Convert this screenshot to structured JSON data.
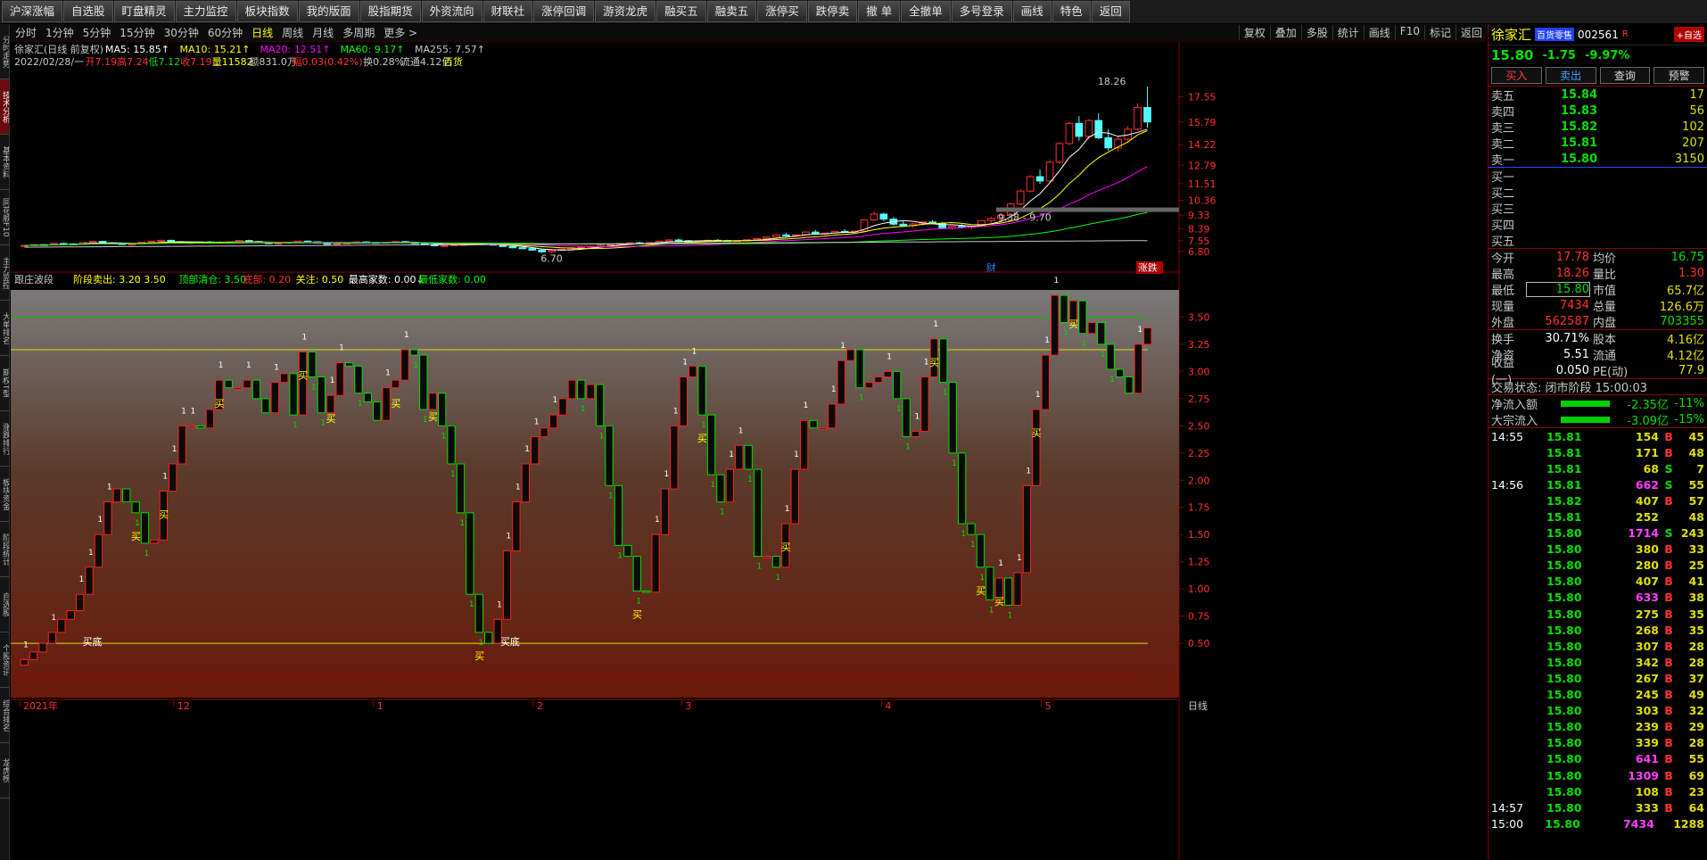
{
  "toolbar": [
    "沪深涨幅",
    "自选股",
    "盯盘精灵",
    "主力监控",
    "板块指数",
    "我的版面",
    "股指期货",
    "外资流向",
    "财联社",
    "涨停回调",
    "游资龙虎",
    "融买五",
    "融卖五",
    "涨停买",
    "跌停卖",
    "撤 单",
    "全撤单",
    "多号登录",
    "画线",
    "特色",
    "返回"
  ],
  "left_tabs": [
    "分时走势",
    "技术分析",
    "基本资料",
    "同花顺F10",
    "主力监控",
    "大单排名",
    "期权T型",
    "涨跌排行",
    "板块资金",
    "阶段统计",
    "自选股",
    "个股资讯",
    "综合排名",
    "龙虎榜"
  ],
  "periods": [
    "分时",
    "1分钟",
    "5分钟",
    "15分钟",
    "30分钟",
    "60分钟",
    "日线",
    "周线",
    "月线",
    "多周期",
    "更多 >"
  ],
  "period_active": "日线",
  "right_buttons": [
    "复权",
    "叠加",
    "多股",
    "统计",
    "画线",
    "F10",
    "标记",
    "返回"
  ],
  "kline": {
    "title": "徐家汇(日线 前复权)",
    "ma_labels": [
      {
        "text": "MA5: 15.85↑",
        "color": "#ffffff"
      },
      {
        "text": "MA10: 15.21↑",
        "color": "#ffff00"
      },
      {
        "text": "MA20: 12.51↑",
        "color": "#ff00ff"
      },
      {
        "text": "MA60: 9.17↑",
        "color": "#00ff00"
      },
      {
        "text": "MA255: 7.57↑",
        "color": "#c8c8c8"
      }
    ],
    "info_line": [
      {
        "text": "2022/02/28/一",
        "color": "#c8c8c8"
      },
      {
        "text": "开7.19",
        "color": "#ff3030"
      },
      {
        "text": "高7.24",
        "color": "#ff3030"
      },
      {
        "text": "低7.12",
        "color": "#00e000"
      },
      {
        "text": "收7.19",
        "color": "#ff3030"
      },
      {
        "text": "量11582",
        "color": "#ffff00"
      },
      {
        "text": "额831.0万",
        "color": "#c8c8c8"
      },
      {
        "text": "幅0.03(0.42%)",
        "color": "#ff3030"
      },
      {
        "text": "换0.28%",
        "color": "#c8c8c8"
      },
      {
        "text": "流通4.12亿",
        "color": "#c8c8c8"
      },
      {
        "text": "百货",
        "color": "#ffff00"
      }
    ],
    "y_ticks": [
      "17.55",
      "15.79",
      "14.22",
      "12.79",
      "11.51",
      "10.36",
      "9.33",
      "8.39",
      "7.55",
      "6.80"
    ],
    "price_scale": {
      "min": 6.3,
      "max": 19.5
    },
    "high_label": "18.26",
    "low_label": "6.70",
    "range_label": "9.38 - 9.70",
    "marker_cai": "财",
    "marker_zt": "涨跌",
    "candles": [
      [
        7.2,
        7.25,
        7.15,
        7.22
      ],
      [
        7.22,
        7.3,
        7.18,
        7.28
      ],
      [
        7.28,
        7.32,
        7.2,
        7.25
      ],
      [
        7.25,
        7.4,
        7.22,
        7.36
      ],
      [
        7.36,
        7.42,
        7.3,
        7.33
      ],
      [
        7.33,
        7.38,
        7.25,
        7.3
      ],
      [
        7.3,
        7.45,
        7.28,
        7.42
      ],
      [
        7.42,
        7.55,
        7.4,
        7.5
      ],
      [
        7.5,
        7.52,
        7.38,
        7.4
      ],
      [
        7.4,
        7.45,
        7.3,
        7.35
      ],
      [
        7.35,
        7.4,
        7.25,
        7.28
      ],
      [
        7.28,
        7.35,
        7.22,
        7.32
      ],
      [
        7.32,
        7.48,
        7.3,
        7.45
      ],
      [
        7.45,
        7.55,
        7.42,
        7.5
      ],
      [
        7.5,
        7.62,
        7.45,
        7.58
      ],
      [
        7.58,
        7.6,
        7.45,
        7.48
      ],
      [
        7.48,
        7.52,
        7.35,
        7.38
      ],
      [
        7.38,
        7.45,
        7.3,
        7.42
      ],
      [
        7.42,
        7.5,
        7.38,
        7.46
      ],
      [
        7.46,
        7.52,
        7.4,
        7.44
      ],
      [
        7.44,
        7.5,
        7.36,
        7.4
      ],
      [
        7.4,
        7.48,
        7.34,
        7.45
      ],
      [
        7.45,
        7.6,
        7.42,
        7.56
      ],
      [
        7.56,
        7.62,
        7.48,
        7.5
      ],
      [
        7.5,
        7.55,
        7.4,
        7.42
      ],
      [
        7.42,
        7.46,
        7.3,
        7.34
      ],
      [
        7.34,
        7.4,
        7.25,
        7.38
      ],
      [
        7.38,
        7.48,
        7.35,
        7.44
      ],
      [
        7.44,
        7.55,
        7.42,
        7.52
      ],
      [
        7.52,
        7.58,
        7.45,
        7.48
      ],
      [
        7.48,
        7.5,
        7.35,
        7.38
      ],
      [
        7.38,
        7.42,
        7.28,
        7.3
      ],
      [
        7.3,
        7.36,
        7.22,
        7.34
      ],
      [
        7.34,
        7.45,
        7.32,
        7.42
      ],
      [
        7.42,
        7.5,
        7.38,
        7.47
      ],
      [
        7.47,
        7.52,
        7.4,
        7.43
      ],
      [
        7.43,
        7.48,
        7.36,
        7.4
      ],
      [
        7.4,
        7.46,
        7.34,
        7.44
      ],
      [
        7.44,
        7.52,
        7.4,
        7.49
      ],
      [
        7.49,
        7.55,
        7.42,
        7.45
      ],
      [
        7.45,
        7.48,
        7.32,
        7.35
      ],
      [
        7.35,
        7.4,
        7.25,
        7.28
      ],
      [
        7.28,
        7.32,
        7.15,
        7.2
      ],
      [
        7.2,
        7.26,
        7.1,
        7.22
      ],
      [
        7.22,
        7.3,
        7.18,
        7.27
      ],
      [
        7.27,
        7.35,
        7.22,
        7.3
      ],
      [
        7.3,
        7.38,
        7.26,
        7.34
      ],
      [
        7.34,
        7.4,
        7.28,
        7.31
      ],
      [
        7.31,
        7.36,
        7.22,
        7.25
      ],
      [
        7.25,
        7.3,
        7.12,
        7.15
      ],
      [
        7.15,
        7.2,
        7.02,
        7.06
      ],
      [
        7.06,
        7.12,
        6.95,
        7.0
      ],
      [
        7.0,
        7.05,
        6.85,
        6.9
      ],
      [
        6.9,
        6.95,
        6.7,
        6.78
      ],
      [
        6.78,
        6.9,
        6.72,
        6.88
      ],
      [
        6.88,
        7.0,
        6.85,
        6.96
      ],
      [
        6.96,
        7.1,
        6.92,
        7.06
      ],
      [
        7.06,
        7.15,
        7.0,
        7.1
      ],
      [
        7.1,
        7.2,
        7.05,
        7.16
      ],
      [
        7.16,
        7.3,
        7.12,
        7.25
      ],
      [
        7.25,
        7.35,
        7.2,
        7.3
      ],
      [
        7.3,
        7.4,
        7.25,
        7.36
      ],
      [
        7.36,
        7.45,
        7.3,
        7.4
      ],
      [
        7.4,
        7.48,
        7.34,
        7.38
      ],
      [
        7.38,
        7.44,
        7.3,
        7.42
      ],
      [
        7.42,
        7.55,
        7.4,
        7.52
      ],
      [
        7.52,
        7.65,
        7.5,
        7.6
      ],
      [
        7.6,
        7.7,
        7.52,
        7.55
      ],
      [
        7.55,
        7.6,
        7.45,
        7.5
      ],
      [
        7.5,
        7.58,
        7.42,
        7.54
      ],
      [
        7.54,
        7.62,
        7.5,
        7.58
      ],
      [
        7.58,
        7.66,
        7.52,
        7.56
      ],
      [
        7.56,
        7.62,
        7.48,
        7.52
      ],
      [
        7.52,
        7.58,
        7.45,
        7.55
      ],
      [
        7.55,
        7.65,
        7.52,
        7.62
      ],
      [
        7.62,
        7.75,
        7.6,
        7.7
      ],
      [
        7.7,
        7.85,
        7.65,
        7.8
      ],
      [
        7.8,
        8.0,
        7.75,
        7.95
      ],
      [
        7.95,
        8.1,
        7.85,
        7.9
      ],
      [
        7.9,
        8.0,
        7.8,
        7.96
      ],
      [
        7.96,
        8.2,
        7.92,
        8.15
      ],
      [
        8.15,
        8.3,
        8.0,
        8.05
      ],
      [
        8.05,
        8.12,
        7.95,
        8.08
      ],
      [
        8.08,
        8.25,
        8.05,
        8.2
      ],
      [
        8.2,
        8.35,
        8.1,
        8.15
      ],
      [
        8.15,
        8.25,
        8.0,
        8.22
      ],
      [
        8.22,
        9.05,
        8.2,
        9.0
      ],
      [
        9.0,
        9.6,
        8.9,
        9.4
      ],
      [
        9.4,
        9.5,
        8.9,
        9.05
      ],
      [
        9.05,
        9.2,
        8.6,
        8.7
      ],
      [
        8.7,
        8.9,
        8.5,
        8.6
      ],
      [
        8.6,
        8.8,
        8.45,
        8.72
      ],
      [
        8.72,
        8.9,
        8.6,
        8.85
      ],
      [
        8.85,
        9.0,
        8.7,
        8.75
      ],
      [
        8.75,
        8.85,
        8.4,
        8.45
      ],
      [
        8.45,
        8.6,
        8.3,
        8.55
      ],
      [
        8.55,
        8.7,
        8.4,
        8.48
      ],
      [
        8.48,
        8.6,
        8.35,
        8.56
      ],
      [
        8.56,
        9.0,
        8.5,
        8.95
      ],
      [
        8.95,
        9.2,
        8.8,
        9.1
      ],
      [
        9.1,
        9.4,
        9.0,
        9.3
      ],
      [
        9.3,
        10.2,
        9.25,
        10.1
      ],
      [
        10.1,
        11.1,
        10.0,
        11.0
      ],
      [
        11.0,
        12.1,
        10.9,
        12.0
      ],
      [
        12.0,
        12.5,
        11.5,
        11.7
      ],
      [
        11.7,
        13.2,
        11.6,
        13.0
      ],
      [
        13.0,
        14.4,
        12.9,
        14.3
      ],
      [
        14.3,
        15.8,
        14.2,
        15.7
      ],
      [
        15.7,
        16.2,
        14.5,
        14.8
      ],
      [
        14.8,
        16.0,
        14.6,
        15.9
      ],
      [
        15.9,
        16.4,
        14.6,
        14.7
      ],
      [
        14.7,
        15.3,
        13.8,
        14.0
      ],
      [
        14.0,
        14.8,
        13.7,
        14.6
      ],
      [
        14.6,
        15.5,
        14.4,
        15.3
      ],
      [
        15.3,
        17.1,
        15.2,
        16.8
      ],
      [
        16.8,
        18.26,
        15.4,
        15.8
      ]
    ]
  },
  "indicator": {
    "name": "跟庄波段",
    "labels": [
      {
        "text": "阶段卖出: 3.20",
        "color": "#ffff00"
      },
      {
        "text": ": 3.50",
        "color": "#ffff00"
      },
      {
        "text": "顶部清仓: 3.50",
        "color": "#00ff00"
      },
      {
        "text": "底部: 0.20",
        "color": "#ff3030"
      },
      {
        "text": "关注: 0.50",
        "color": "#ffff00"
      },
      {
        "text": "最高家数: 0.00↓",
        "color": "#ffffff"
      },
      {
        "text": "最低家数: 0.00",
        "color": "#00ff00"
      }
    ],
    "y_ticks": [
      "3.50",
      "3.25",
      "3.00",
      "2.75",
      "2.50",
      "2.25",
      "2.00",
      "1.75",
      "1.50",
      "1.25",
      "1.00",
      "0.75",
      "0.50"
    ],
    "scale": {
      "min": 0.0,
      "max": 3.75
    },
    "levels": [
      {
        "value": 3.5,
        "color": "#00c000"
      },
      {
        "value": 3.2,
        "color": "#e0e000"
      },
      {
        "value": 0.5,
        "color": "#e0e000"
      },
      {
        "value": 0.2,
        "color": "#a00000"
      }
    ],
    "values": [
      0.35,
      0.42,
      0.5,
      0.6,
      0.72,
      0.8,
      0.95,
      1.2,
      1.5,
      1.8,
      1.92,
      1.8,
      1.7,
      1.42,
      1.45,
      1.9,
      2.15,
      2.5,
      2.5,
      2.48,
      2.65,
      2.92,
      2.85,
      2.85,
      2.92,
      2.75,
      2.62,
      2.9,
      2.98,
      2.6,
      3.18,
      2.95,
      2.62,
      2.78,
      3.08,
      3.05,
      2.8,
      2.72,
      2.55,
      2.85,
      2.92,
      3.2,
      3.15,
      2.65,
      2.8,
      2.5,
      2.15,
      1.7,
      0.95,
      0.6,
      0.5,
      0.72,
      1.35,
      1.8,
      2.15,
      2.4,
      2.48,
      2.6,
      2.75,
      2.92,
      2.75,
      2.88,
      2.5,
      1.95,
      1.4,
      1.3,
      0.98,
      0.97,
      1.5,
      1.92,
      2.5,
      2.95,
      3.05,
      2.6,
      2.05,
      1.8,
      2.1,
      2.32,
      2.1,
      1.3,
      1.3,
      1.2,
      1.6,
      2.1,
      2.55,
      2.48,
      2.48,
      2.7,
      3.1,
      3.2,
      2.85,
      2.9,
      2.95,
      3.0,
      2.75,
      2.4,
      2.45,
      2.95,
      3.3,
      2.9,
      2.25,
      1.6,
      1.5,
      1.2,
      0.9,
      1.1,
      0.85,
      1.15,
      1.95,
      2.65,
      3.15,
      3.7,
      3.45,
      3.65,
      3.35,
      3.45,
      3.25,
      3.02,
      2.95,
      2.8,
      3.25,
      3.4
    ],
    "buy_labels": [
      {
        "i": 12,
        "text": "买"
      },
      {
        "i": 15,
        "text": "买"
      },
      {
        "i": 21,
        "text": "买"
      },
      {
        "i": 30,
        "text": "买"
      },
      {
        "i": 33,
        "text": "买"
      },
      {
        "i": 40,
        "text": "买"
      },
      {
        "i": 44,
        "text": "买"
      },
      {
        "i": 49,
        "text": "买"
      },
      {
        "i": 66,
        "text": "买"
      },
      {
        "i": 73,
        "text": "买"
      },
      {
        "i": 82,
        "text": "买"
      },
      {
        "i": 98,
        "text": "买"
      },
      {
        "i": 103,
        "text": "买"
      },
      {
        "i": 105,
        "text": "买"
      },
      {
        "i": 109,
        "text": "买"
      },
      {
        "i": 113,
        "text": "买"
      }
    ],
    "bottom_labels": [
      {
        "i": 6,
        "text": "买底"
      },
      {
        "i": 51,
        "text": "买底"
      }
    ]
  },
  "x_axis": [
    "2021年",
    "12",
    "1",
    "2",
    "3",
    "4",
    "5"
  ],
  "x_axis_right": "日线",
  "quote": {
    "name": "徐家汇",
    "industry": "百货零售",
    "code": "002561",
    "r": "R",
    "add_btn": "+自选",
    "price": "15.80",
    "change": "-1.75",
    "pct": "-9.97%",
    "buttons": [
      "买入",
      "卖出",
      "查询",
      "预警"
    ],
    "asks": [
      [
        "卖五",
        "15.84",
        "17"
      ],
      [
        "卖四",
        "15.83",
        "56"
      ],
      [
        "卖三",
        "15.82",
        "102"
      ],
      [
        "卖二",
        "15.81",
        "207"
      ],
      [
        "卖一",
        "15.80",
        "3150"
      ]
    ],
    "bids": [
      [
        "买一",
        "",
        ""
      ],
      [
        "买二",
        "",
        ""
      ],
      [
        "买三",
        "",
        ""
      ],
      [
        "买四",
        "",
        ""
      ],
      [
        "买五",
        "",
        ""
      ]
    ],
    "stats": [
      [
        "今开",
        "17.78",
        "均价",
        "16.75"
      ],
      [
        "最高",
        "18.26",
        "量比",
        "1.30"
      ],
      [
        "最低",
        "15.80",
        "市值",
        "65.7亿"
      ],
      [
        "现量",
        "7434",
        "总量",
        "126.6万"
      ],
      [
        "外盘",
        "562587",
        "内盘",
        "703355"
      ]
    ],
    "stats2": [
      [
        "换手",
        "30.71%",
        "股本",
        "4.16亿"
      ],
      [
        "净资",
        "5.51",
        "流通",
        "4.12亿"
      ],
      [
        "收益(一)",
        "0.050",
        "PE(动)",
        "77.9"
      ]
    ],
    "trade_status": "交易状态: 闭市阶段 15:00:03",
    "flows": [
      [
        "净流入额",
        "-2.35亿",
        "-11%"
      ],
      [
        "大宗流入",
        "-3.09亿",
        "-15%"
      ]
    ],
    "ticks": [
      [
        "14:55",
        "15.81",
        "154",
        "B",
        "45"
      ],
      [
        "",
        "15.81",
        "171",
        "B",
        "48"
      ],
      [
        "",
        "15.81",
        "68",
        "S",
        "7"
      ],
      [
        "14:56",
        "15.81",
        "662",
        "S",
        "55"
      ],
      [
        "",
        "15.82",
        "407",
        "B",
        "57"
      ],
      [
        "",
        "15.81",
        "252",
        "",
        "48"
      ],
      [
        "",
        "15.80",
        "1714",
        "S",
        "243"
      ],
      [
        "",
        "15.80",
        "380",
        "B",
        "33"
      ],
      [
        "",
        "15.80",
        "280",
        "B",
        "25"
      ],
      [
        "",
        "15.80",
        "407",
        "B",
        "41"
      ],
      [
        "",
        "15.80",
        "633",
        "B",
        "38"
      ],
      [
        "",
        "15.80",
        "275",
        "B",
        "35"
      ],
      [
        "",
        "15.80",
        "268",
        "B",
        "35"
      ],
      [
        "",
        "15.80",
        "307",
        "B",
        "28"
      ],
      [
        "",
        "15.80",
        "342",
        "B",
        "28"
      ],
      [
        "",
        "15.80",
        "267",
        "B",
        "37"
      ],
      [
        "",
        "15.80",
        "245",
        "B",
        "49"
      ],
      [
        "",
        "15.80",
        "303",
        "B",
        "32"
      ],
      [
        "",
        "15.80",
        "239",
        "B",
        "29"
      ],
      [
        "",
        "15.80",
        "339",
        "B",
        "28"
      ],
      [
        "",
        "15.80",
        "641",
        "B",
        "55"
      ],
      [
        "",
        "15.80",
        "1309",
        "B",
        "69"
      ],
      [
        "",
        "15.80",
        "108",
        "B",
        "23"
      ],
      [
        "14:57",
        "15.80",
        "333",
        "B",
        "64"
      ],
      [
        "15:00",
        "15.80",
        "7434",
        "",
        "1288"
      ]
    ]
  }
}
